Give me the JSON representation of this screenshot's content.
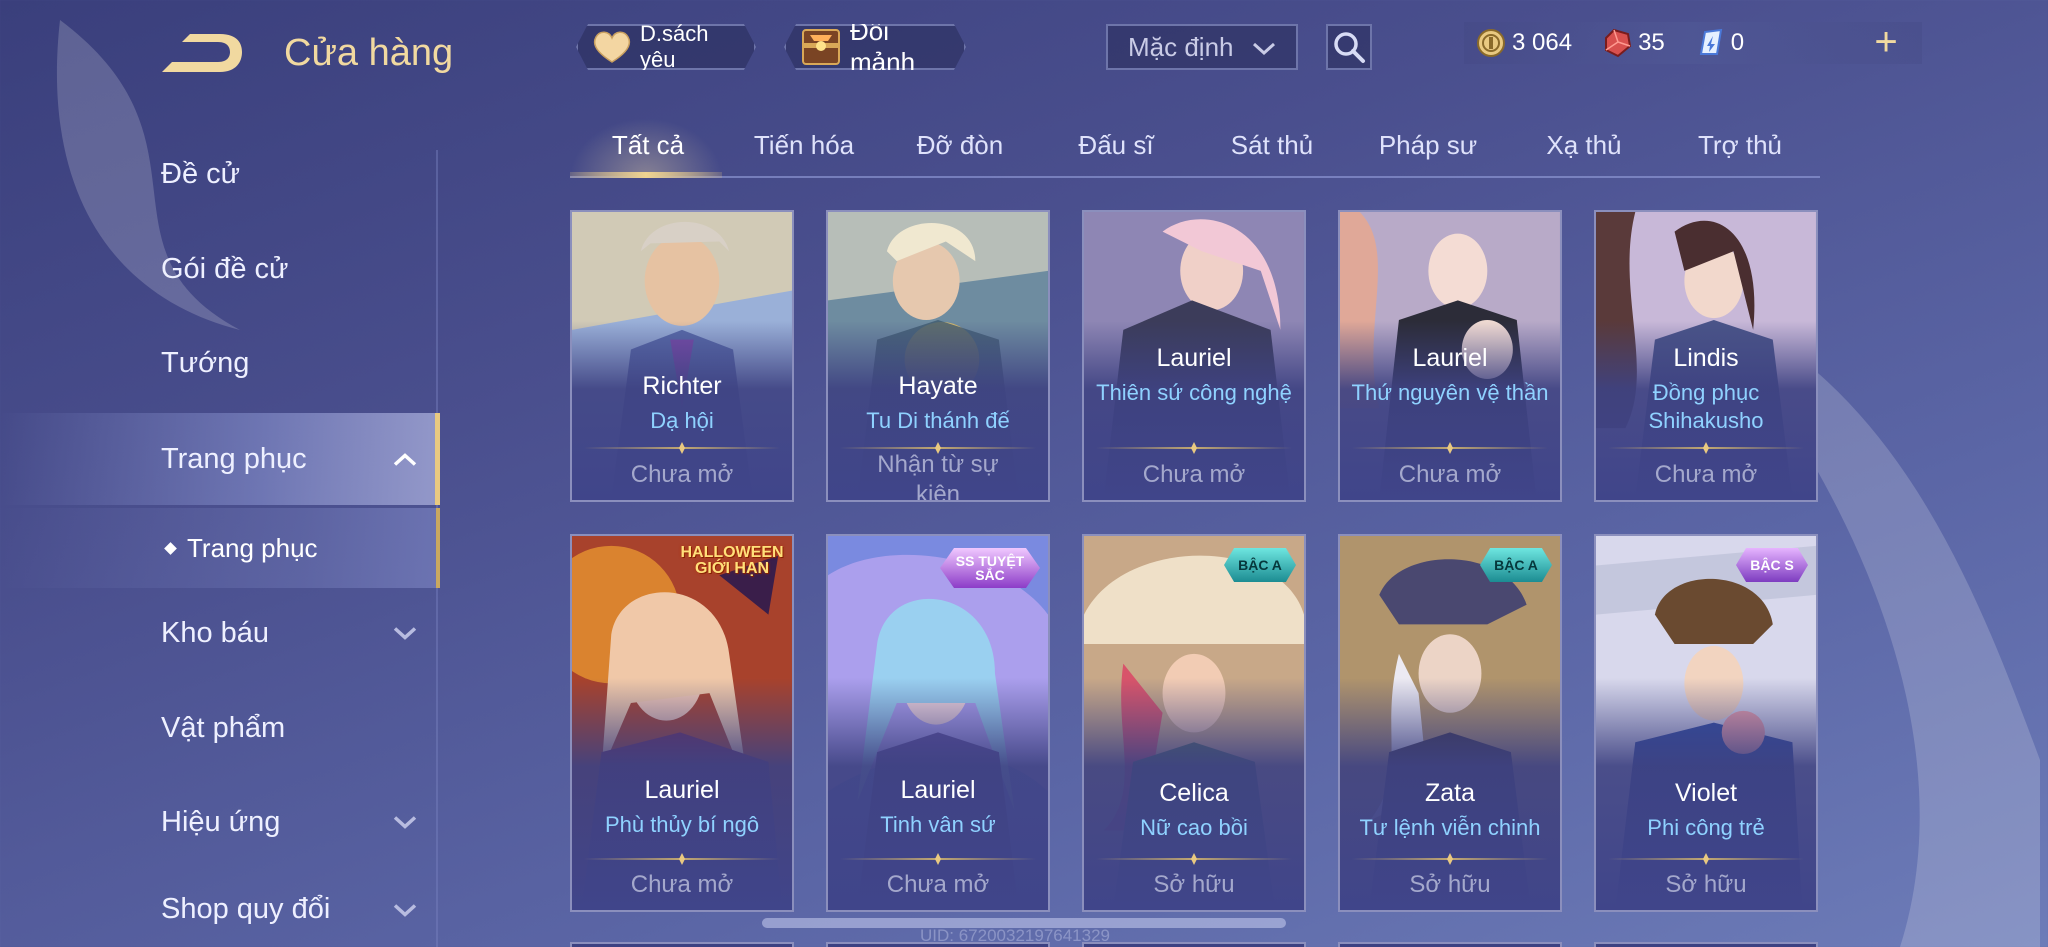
{
  "header": {
    "title": "Cửa hàng",
    "back_icon": "back-arrow-icon",
    "favorites_label": "D.sách yêu",
    "shard_label": "Đổi mảnh",
    "sort_value": "Mặc định",
    "currencies": [
      {
        "icon": "gold-coin-icon",
        "value": "3 064"
      },
      {
        "icon": "ruby-gem-icon",
        "value": "35"
      },
      {
        "icon": "voucher-icon",
        "value": "0"
      }
    ],
    "plus_label": "+"
  },
  "sidebar": {
    "items": [
      {
        "label": "Đề cử"
      },
      {
        "label": "Gói đề cử"
      },
      {
        "label": "Tướng"
      },
      {
        "label": "Trang phục"
      },
      {
        "label": "Kho báu"
      },
      {
        "label": "Vật phẩm"
      },
      {
        "label": "Hiệu ứng"
      },
      {
        "label": "Shop quy đổi"
      }
    ],
    "sub_item": "Trang phục"
  },
  "tabs": [
    "Tất cả",
    "Tiến hóa",
    "Đỡ đòn",
    "Đấu sĩ",
    "Sát thủ",
    "Pháp sư",
    "Xạ thủ",
    "Trợ thủ"
  ],
  "cards": [
    {
      "hero": "Richter",
      "skin": "Dạ hội",
      "status": "Chưa mở",
      "badge": ""
    },
    {
      "hero": "Hayate",
      "skin": "Tu Di thánh đế",
      "status": "Nhận từ sự kiện",
      "badge": ""
    },
    {
      "hero": "Lauriel",
      "skin": "Thiên sứ công nghệ",
      "status": "Chưa mở",
      "badge": ""
    },
    {
      "hero": "Lauriel",
      "skin": "Thứ nguyên vệ thần",
      "status": "Chưa mở",
      "badge": ""
    },
    {
      "hero": "Lindis",
      "skin": "Đồng phục Shihakusho",
      "status": "Chưa mở",
      "badge": ""
    },
    {
      "hero": "Lauriel",
      "skin": "Phù thủy bí ngô",
      "status": "Chưa mở",
      "badge": "HALLOWEEN GIỚI HẠN"
    },
    {
      "hero": "Lauriel",
      "skin": "Tinh vân sứ",
      "status": "Chưa mở",
      "badge": "SS TUYỆT SẮC"
    },
    {
      "hero": "Celica",
      "skin": "Nữ cao bồi",
      "status": "Sở hữu",
      "badge": "BẬC A"
    },
    {
      "hero": "Zata",
      "skin": "Tư lệnh viễn chinh",
      "status": "Sở hữu",
      "badge": "BẬC A"
    },
    {
      "hero": "Violet",
      "skin": "Phi công trẻ",
      "status": "Sở hữu",
      "badge": "BẬC S"
    }
  ],
  "footer": {
    "uid": "UID: 6720032197641329"
  },
  "colors": {
    "accent_gold": "#e9c981",
    "skin_name": "#8fd2ff",
    "status": "#a4a8cc",
    "background": "#4a4f8e"
  }
}
